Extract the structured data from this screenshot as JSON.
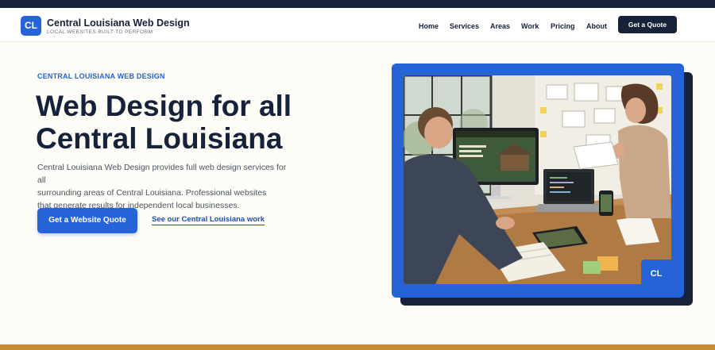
{
  "header": {
    "logo_initials": "CL",
    "brand_name": "Central Louisiana Web Design",
    "tagline": "LOCAL WEBSITES BUILT TO PERFORM",
    "nav": [
      {
        "label": "Home",
        "name": "nav-home"
      },
      {
        "label": "Services",
        "name": "nav-services"
      },
      {
        "label": "Areas",
        "name": "nav-areas"
      },
      {
        "label": "Work",
        "name": "nav-work"
      },
      {
        "label": "Pricing",
        "name": "nav-pricing"
      },
      {
        "label": "About",
        "name": "nav-about"
      }
    ],
    "quote_button": "Get a Quote"
  },
  "hero": {
    "eyebrow": "CENTRAL LOUISIANA WEB DESIGN",
    "headline_line1": "Web Design for all",
    "headline_line2": "Central Louisiana",
    "intro_line1": "Central Louisiana Web Design provides full web design services for all",
    "intro_line2": "surrounding areas of Central Louisiana. Professional websites",
    "intro_line3": "that generate results for independent local businesses.",
    "primary_cta": "Get a Website Quote",
    "secondary_cta": "See our Central Louisiana work",
    "image_badge": "CL"
  },
  "colors": {
    "accent": "#2563d6",
    "navy": "#16213a",
    "page_bg": "#fdfcf6",
    "footer_bar": "#c98a33"
  }
}
